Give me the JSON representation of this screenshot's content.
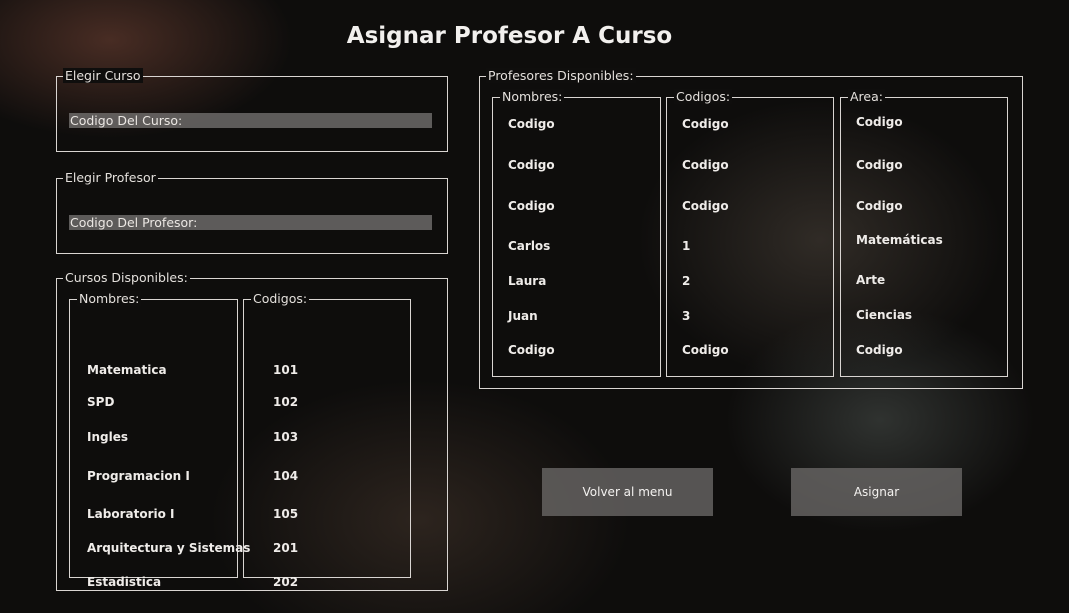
{
  "title": "Asignar Profesor A Curso",
  "elegir_curso": {
    "legend": "Elegir Curso",
    "field_text": "Codigo Del Curso:"
  },
  "elegir_profesor": {
    "legend": "Elegir Profesor",
    "field_text": "Codigo Del Profesor:"
  },
  "cursos": {
    "legend": "Cursos Disponibles:",
    "nombres_legend": "Nombres:",
    "codigos_legend": "Codigos:",
    "nombres": [
      "Matematica",
      "SPD",
      "Ingles",
      "Programacion I",
      "Laboratorio I",
      "Arquitectura y Sistemas",
      "Estadistica"
    ],
    "codigos": [
      "101",
      "102",
      "103",
      "104",
      "105",
      "201",
      "202"
    ]
  },
  "profesores": {
    "legend": "Profesores Disponibles:",
    "nombres_legend": "Nombres:",
    "codigos_legend": "Codigos:",
    "area_legend": "Area:",
    "nombres": [
      "Codigo",
      "Codigo",
      "Codigo",
      "Carlos",
      "Laura",
      "Juan",
      "Codigo"
    ],
    "codigos": [
      "Codigo",
      "Codigo",
      "Codigo",
      "1",
      "2",
      "3",
      "Codigo"
    ],
    "areas": [
      "Codigo",
      "Codigo",
      "Codigo",
      "Matemáticas",
      "Arte",
      "Ciencias",
      "Codigo"
    ]
  },
  "buttons": {
    "volver": "Volver al menu",
    "asignar": "Asignar"
  }
}
